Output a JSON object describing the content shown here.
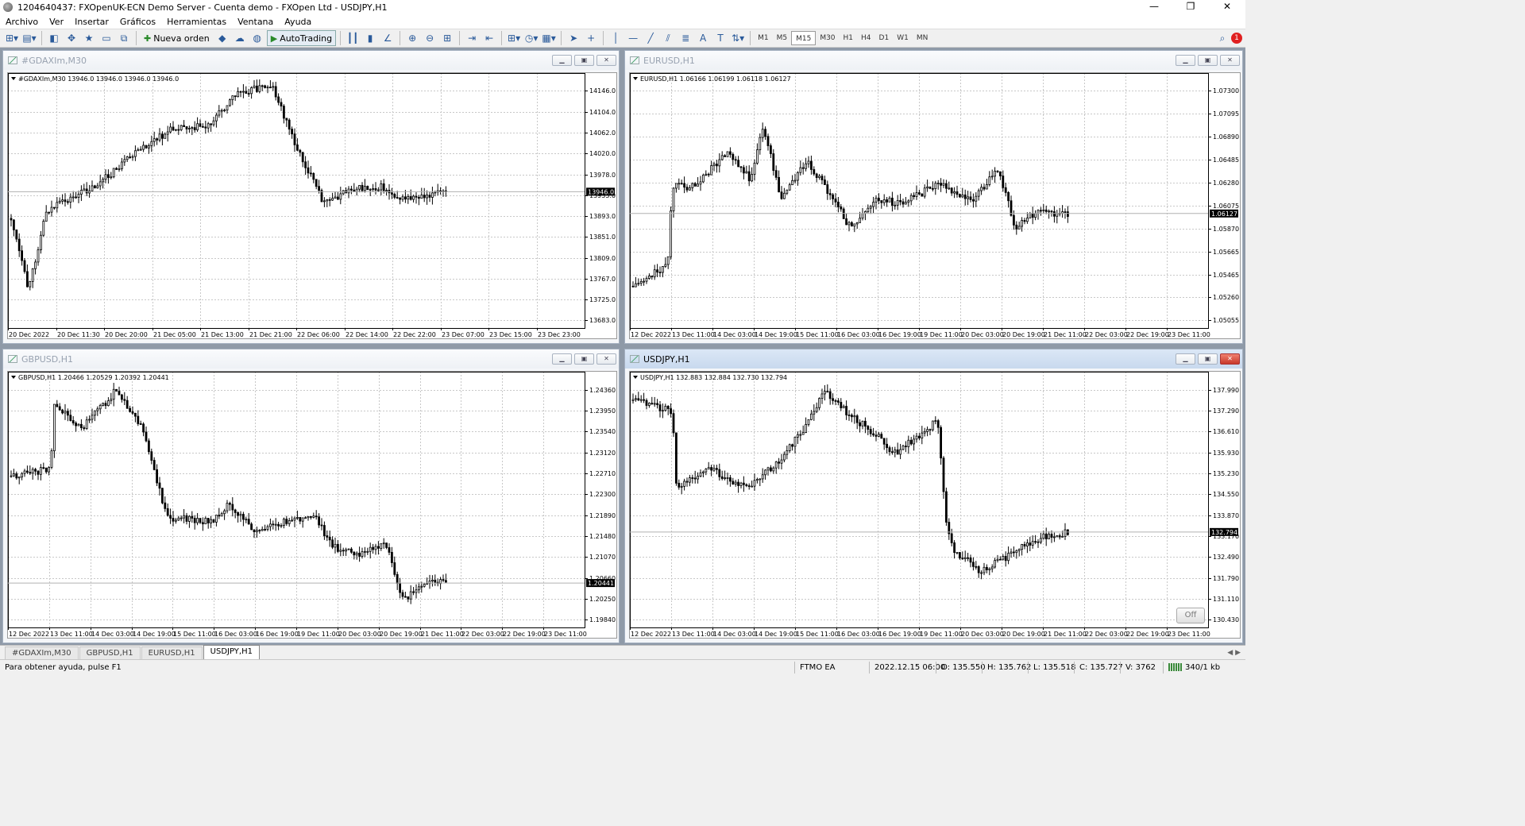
{
  "window": {
    "title": "1204640437: FXOpenUK-ECN Demo Server - Cuenta demo - FXOpen Ltd - USDJPY,H1",
    "minimize": "—",
    "maximize": "❐",
    "close": "✕"
  },
  "menu": [
    "Archivo",
    "Ver",
    "Insertar",
    "Gráficos",
    "Herramientas",
    "Ventana",
    "Ayuda"
  ],
  "toolbar": {
    "new_order": "Nueva orden",
    "autotrading": "AutoTrading",
    "timeframes": [
      "M1",
      "M5",
      "M15",
      "M30",
      "H1",
      "H4",
      "D1",
      "W1",
      "MN"
    ],
    "selected_timeframe": "M15",
    "alert_count": "1"
  },
  "charts": [
    {
      "id": "dax",
      "title": "#GDAXIm,M30",
      "info": "#GDAXIm,M30  13946.0 13946.0 13946.0 13946.0",
      "current_price": "13946.0",
      "active": false,
      "price_labels": [
        "14146.0",
        "14104.0",
        "14062.0",
        "14020.0",
        "13978.0",
        "13935.0",
        "13893.0",
        "13851.0",
        "13809.0",
        "13767.0",
        "13725.0",
        "13683.0"
      ],
      "time_labels": [
        "20 Dec 2022",
        "20 Dec 11:30",
        "20 Dec 20:00",
        "21 Dec 05:00",
        "21 Dec 13:00",
        "21 Dec 21:00",
        "22 Dec 06:00",
        "22 Dec 14:00",
        "22 Dec 22:00",
        "23 Dec 07:00",
        "23 Dec 15:00",
        "23 Dec 23:00"
      ]
    },
    {
      "id": "eurusd",
      "title": "EURUSD,H1",
      "info": "EURUSD,H1  1.06166 1.06199 1.06118 1.06127",
      "current_price": "1.06127",
      "active": false,
      "price_labels": [
        "1.07300",
        "1.07095",
        "1.06890",
        "1.06485",
        "1.06280",
        "1.06075",
        "1.05870",
        "1.05665",
        "1.05465",
        "1.05260",
        "1.05055"
      ],
      "time_labels": [
        "12 Dec 2022",
        "13 Dec 11:00",
        "14 Dec 03:00",
        "14 Dec 19:00",
        "15 Dec 11:00",
        "16 Dec 03:00",
        "16 Dec 19:00",
        "19 Dec 11:00",
        "20 Dec 03:00",
        "20 Dec 19:00",
        "21 Dec 11:00",
        "22 Dec 03:00",
        "22 Dec 19:00",
        "23 Dec 11:00"
      ]
    },
    {
      "id": "gbpusd",
      "title": "GBPUSD,H1",
      "info": "GBPUSD,H1  1.20466 1.20529 1.20392 1.20441",
      "current_price": "1.20441",
      "active": false,
      "price_labels": [
        "1.24360",
        "1.23950",
        "1.23540",
        "1.23120",
        "1.22710",
        "1.22300",
        "1.21890",
        "1.21480",
        "1.21070",
        "1.20660",
        "1.20250",
        "1.19840"
      ],
      "time_labels": [
        "12 Dec 2022",
        "13 Dec 11:00",
        "14 Dec 03:00",
        "14 Dec 19:00",
        "15 Dec 11:00",
        "16 Dec 03:00",
        "16 Dec 19:00",
        "19 Dec 11:00",
        "20 Dec 03:00",
        "20 Dec 19:00",
        "21 Dec 11:00",
        "22 Dec 03:00",
        "22 Dec 19:00",
        "23 Dec 11:00"
      ]
    },
    {
      "id": "usdjpy",
      "title": "USDJPY,H1",
      "info": "USDJPY,H1  132.883 132.884 132.730 132.794",
      "current_price": "132.794",
      "active": true,
      "off_button": "Off",
      "price_labels": [
        "137.990",
        "137.290",
        "136.610",
        "135.930",
        "135.230",
        "134.550",
        "133.870",
        "133.170",
        "132.490",
        "131.790",
        "131.110",
        "130.430"
      ],
      "time_labels": [
        "12 Dec 2022",
        "13 Dec 11:00",
        "14 Dec 03:00",
        "14 Dec 19:00",
        "15 Dec 11:00",
        "16 Dec 03:00",
        "16 Dec 19:00",
        "19 Dec 11:00",
        "20 Dec 03:00",
        "20 Dec 19:00",
        "21 Dec 11:00",
        "22 Dec 03:00",
        "22 Dec 19:00",
        "23 Dec 11:00"
      ]
    }
  ],
  "tabs": [
    "#GDAXIm,M30",
    "GBPUSD,H1",
    "EURUSD,H1",
    "USDJPY,H1"
  ],
  "selected_tab": "USDJPY,H1",
  "status": {
    "help": "Para obtener ayuda, pulse F1",
    "profile": "FTMO EA",
    "datetime": "2022.12.15 06:00",
    "open": "O: 135.550",
    "high": "H: 135.762",
    "low": "L: 135.518",
    "close": "C: 135.727",
    "volume": "V: 3762",
    "traffic": "340/1 kb"
  },
  "colors": {
    "candle": "#000000",
    "grid": "#c8c8c8",
    "active_caption": "#c8d9ee",
    "price_tag": "#000000"
  }
}
